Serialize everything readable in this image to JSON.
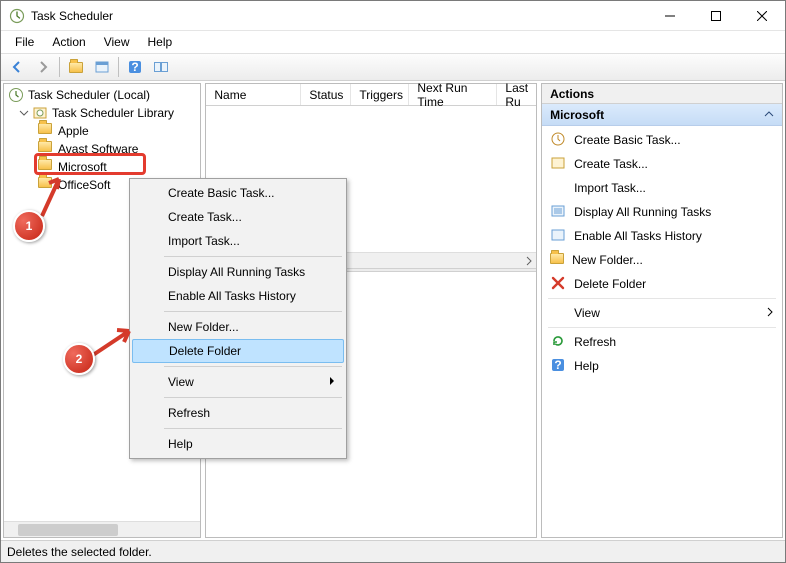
{
  "window": {
    "title": "Task Scheduler"
  },
  "menu": {
    "file": "File",
    "action": "Action",
    "view": "View",
    "help": "Help"
  },
  "tree": {
    "root": "Task Scheduler (Local)",
    "library": "Task Scheduler Library",
    "items": [
      "Apple",
      "Avast Software",
      "Microsoft",
      "OfficeSoft"
    ]
  },
  "columns": {
    "name": "Name",
    "status": "Status",
    "triggers": "Triggers",
    "nextrun": "Next Run Time",
    "lastrun": "Last Ru"
  },
  "actions": {
    "header": "Actions",
    "section": "Microsoft",
    "items": {
      "createbasic": "Create Basic Task...",
      "createtask": "Create Task...",
      "import": "Import Task...",
      "displayrunning": "Display All Running Tasks",
      "enablehistory": "Enable All Tasks History",
      "newfolder": "New Folder...",
      "deletefolder": "Delete Folder",
      "view": "View",
      "refresh": "Refresh",
      "help": "Help"
    }
  },
  "context": {
    "createbasic": "Create Basic Task...",
    "createtask": "Create Task...",
    "import": "Import Task...",
    "displayrunning": "Display All Running Tasks",
    "enablehistory": "Enable All Tasks History",
    "newfolder": "New Folder...",
    "deletefolder": "Delete Folder",
    "view": "View",
    "refresh": "Refresh",
    "help": "Help"
  },
  "status": "Deletes the selected folder.",
  "anno": {
    "one": "1",
    "two": "2"
  }
}
